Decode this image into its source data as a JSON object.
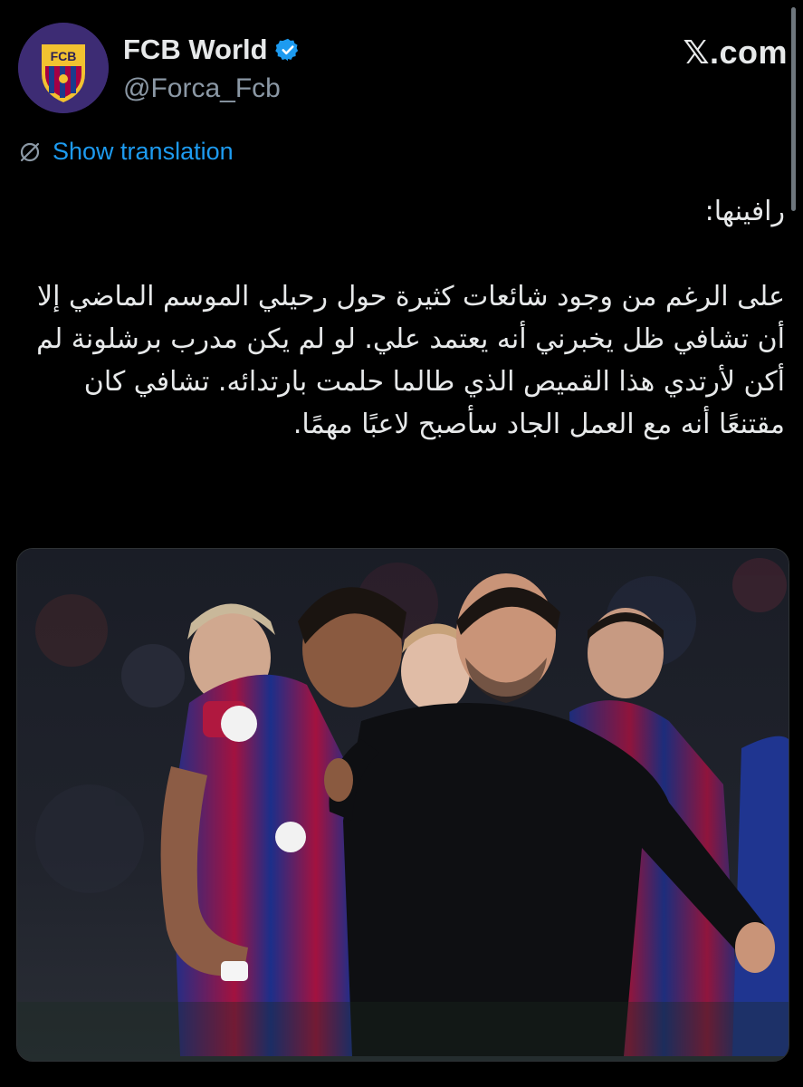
{
  "header": {
    "avatar_label": "FCB",
    "display_name": "FCB World",
    "handle": "@Forca_Fcb",
    "brand": "𝕏.com",
    "verified_icon": "verified-badge-icon"
  },
  "translation": {
    "icon": "globe-slash-icon",
    "label": "Show translation"
  },
  "tweet": {
    "paragraphs": [
      "رافينها:",
      "على الرغم من وجود شائعات كثيرة حول رحيلي الموسم الماضي إلا أن تشافي ظل يخبرني أنه يعتمد علي. لو لم يكن مدرب برشلونة لم أكن لأرتدي هذا القميص الذي طالما حلمت بارتدائه. تشافي كان مقتنعًا أنه مع العمل الجاد سأصبح لاعبًا مهمًا."
    ]
  },
  "media": {
    "description": "photo"
  },
  "colors": {
    "background": "#000000",
    "text": "#e7e9ea",
    "secondary": "#8b98a5",
    "link": "#1d9bf0",
    "verified": "#1d9bf0"
  }
}
